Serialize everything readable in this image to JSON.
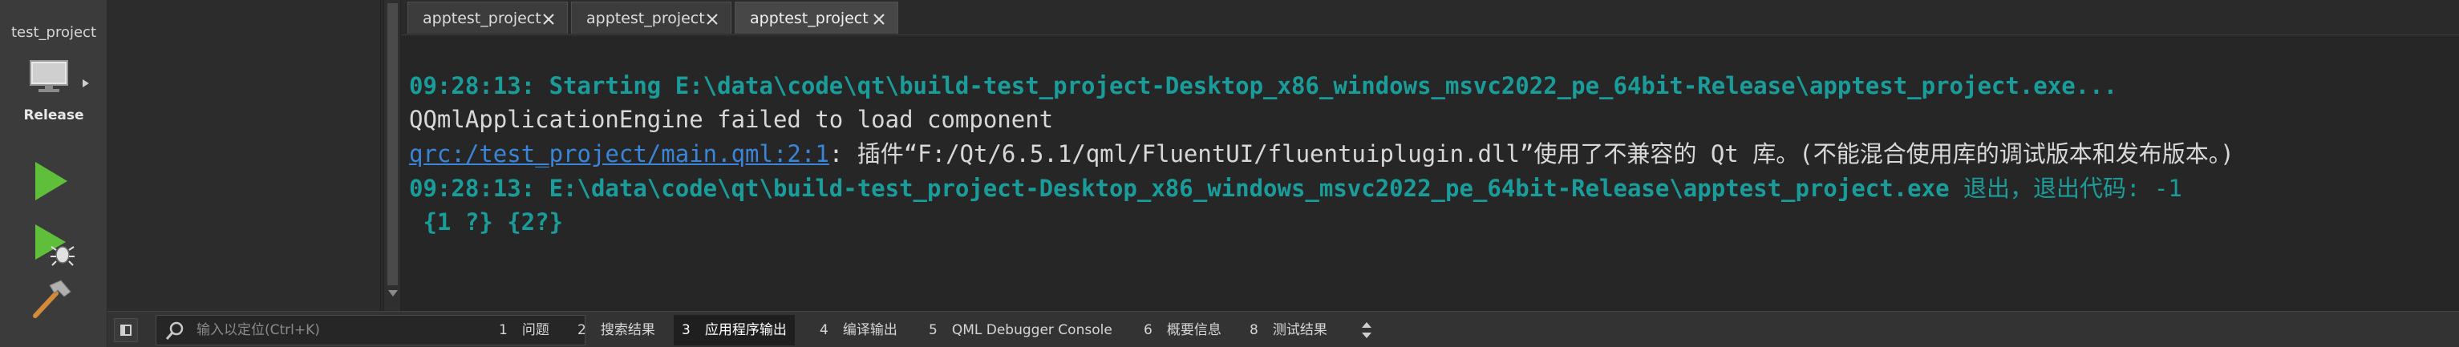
{
  "modebar": {
    "kit_name": "test_project",
    "build_config": "Release",
    "icons": {
      "target": "monitor-icon",
      "run": "run-icon",
      "debug": "debug-run-icon",
      "build": "hammer-icon"
    }
  },
  "tabs": [
    {
      "label": "apptest_project",
      "active": false
    },
    {
      "label": "apptest_project",
      "active": false
    },
    {
      "label": "apptest_project",
      "active": true
    }
  ],
  "output": {
    "line1": "09:28:13: Starting E:\\data\\code\\qt\\build-test_project-Desktop_x86_windows_msvc2022_pe_64bit-Release\\apptest_project.exe...",
    "line2": "QQmlApplicationEngine failed to load component",
    "line3_link": "qrc:/test_project/main.qml:2:1",
    "line3_text": ": 插件“F:/Qt/6.5.1/qml/FluentUI/fluentuiplugin.dll”使用了不兼容的 Qt 库。(不能混合使用库的调试版本和发布版本。)",
    "line4_path": "09:28:13: E:\\data\\code\\qt\\build-test_project-Desktop_x86_windows_msvc2022_pe_64bit-Release\\apptest_project.exe",
    "line4_exit": " 退出，退出代码: -1",
    "line5": " {1 ?} {2?}"
  },
  "statusbar": {
    "locator_placeholder": "输入以定位(Ctrl+K)",
    "panes": [
      {
        "num": "1",
        "label": "问题",
        "active": false
      },
      {
        "num": "2",
        "label": "搜索结果",
        "active": false
      },
      {
        "num": "3",
        "label": "应用程序输出",
        "active": true
      },
      {
        "num": "4",
        "label": "编译输出",
        "active": false
      },
      {
        "num": "5",
        "label": "QML Debugger Console",
        "active": false
      },
      {
        "num": "6",
        "label": "概要信息",
        "active": false
      },
      {
        "num": "8",
        "label": "测试结果",
        "active": false
      }
    ]
  },
  "colors": {
    "teal": "#1a9d9a",
    "link": "#3a85d8",
    "run_green": "#5fbf3a"
  }
}
